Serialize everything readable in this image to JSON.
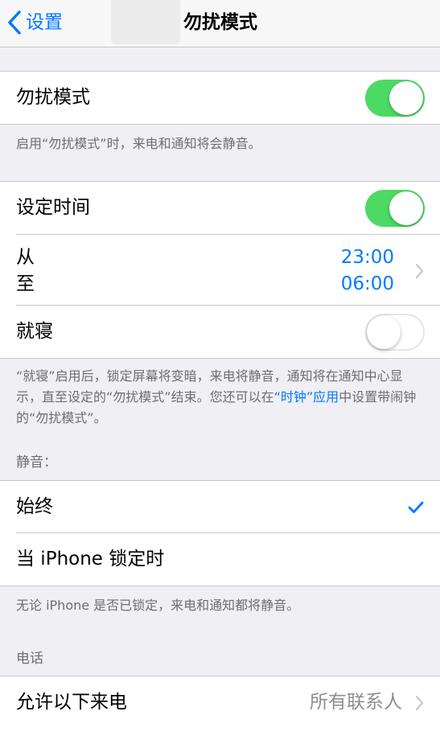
{
  "nav": {
    "back_label": "设置",
    "title": "勿扰模式"
  },
  "dnd": {
    "label": "勿扰模式",
    "toggle_on": true,
    "note": "启用“勿扰模式”时，来电和通知将会静音。"
  },
  "schedule": {
    "label": "设定时间",
    "toggle_on": true,
    "from_label": "从",
    "to_label": "至",
    "from_time": "23:00",
    "to_time": "06:00",
    "bedtime_label": "就寝",
    "bedtime_on": false,
    "note_part1": "“就寝”启用后，锁定屏幕将变暗，来电将静音，通知将在通知中心显示，直至设定的“勿扰模式”结束。您还可以在",
    "note_link": "“时钟”应用",
    "note_part2": "中设置带闹钟的“勿扰模式”。"
  },
  "silence": {
    "header": "静音：",
    "always_label": "始终",
    "always_selected": true,
    "locked_label": "当 iPhone 锁定时",
    "note": "无论 iPhone 是否已锁定，来电和通知都将静音。"
  },
  "phone": {
    "header": "电话",
    "allow_label": "允许以下来电",
    "allow_value": "所有联系人"
  },
  "colors": {
    "accent": "#007aff",
    "toggle_on": "#4cd964",
    "secondary_text": "#6d6d72",
    "background": "#efeff4"
  }
}
